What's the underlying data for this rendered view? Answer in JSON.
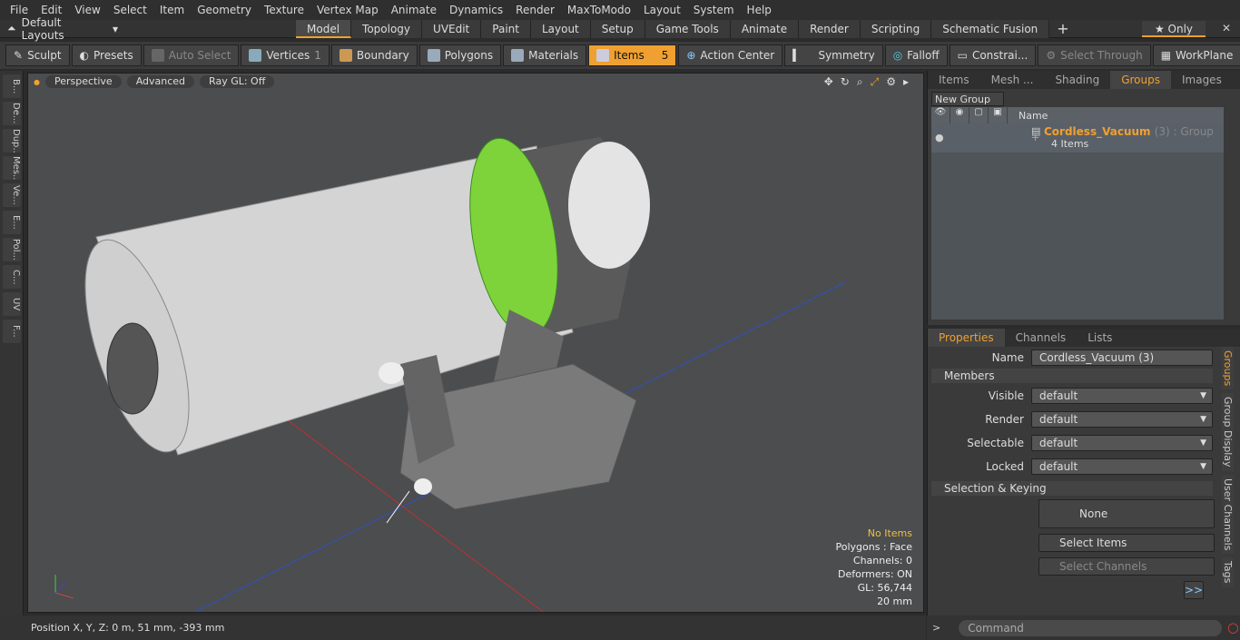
{
  "menu": [
    "File",
    "Edit",
    "View",
    "Select",
    "Item",
    "Geometry",
    "Texture",
    "Vertex Map",
    "Animate",
    "Dynamics",
    "Render",
    "MaxToModo",
    "Layout",
    "System",
    "Help"
  ],
  "layout": {
    "default_layouts": "Default Layouts",
    "tabs": [
      "Model",
      "Topology",
      "UVEdit",
      "Paint",
      "Layout",
      "Setup",
      "Game Tools",
      "Animate",
      "Render",
      "Scripting",
      "Schematic Fusion"
    ],
    "active_tab": "Model",
    "only_label": "Only"
  },
  "toolbar": {
    "sculpt": "Sculpt",
    "presets": "Presets",
    "auto_select": "Auto Select",
    "vertices": "Vertices",
    "vertices_count": "1",
    "boundary": "Boundary",
    "polygons": "Polygons",
    "materials": "Materials",
    "items": "Items",
    "items_count": "5",
    "action_center": "Action Center",
    "symmetry": "Symmetry",
    "falloff": "Falloff",
    "constraints": "Constrai...",
    "select_through": "Select Through",
    "workplane": "WorkPlane"
  },
  "left_tabs": [
    "B...",
    "De...",
    "Dup...",
    "Mes...",
    "Ve...",
    "E...",
    "Pol...",
    "C...",
    "UV",
    "F..."
  ],
  "viewport": {
    "perspective": "Perspective",
    "advanced": "Advanced",
    "raygl": "Ray GL: Off",
    "info": {
      "items": "No Items",
      "polygons": "Polygons : Face",
      "channels": "Channels: 0",
      "deformers": "Deformers: ON",
      "gl": "GL: 56,744",
      "scale": "20 mm"
    }
  },
  "status": {
    "position": "Position X, Y, Z:   0 m, 51 mm, -393 mm"
  },
  "groups_panel": {
    "tabs": [
      "Items",
      "Mesh ...",
      "Shading",
      "Groups",
      "Images"
    ],
    "active_tab": "Groups",
    "new_group": "New Group",
    "name_header": "Name",
    "group_name": "Cordless_Vacuum",
    "group_suffix": "(3) : Group",
    "group_items": "4 Items"
  },
  "properties": {
    "tabs": [
      "Properties",
      "Channels",
      "Lists"
    ],
    "active_tab": "Properties",
    "name_label": "Name",
    "name_value": "Cordless_Vacuum (3)",
    "members": "Members",
    "visible_label": "Visible",
    "visible_value": "default",
    "render_label": "Render",
    "render_value": "default",
    "selectable_label": "Selectable",
    "selectable_value": "default",
    "locked_label": "Locked",
    "locked_value": "default",
    "selection_keying": "Selection & Keying",
    "none": "None",
    "select_items": "Select Items",
    "select_channels": "Select Channels",
    "more": ">>",
    "side_tabs": [
      "Groups",
      "Group Display",
      "User Channels",
      "Tags"
    ]
  },
  "command": {
    "placeholder": "Command"
  }
}
